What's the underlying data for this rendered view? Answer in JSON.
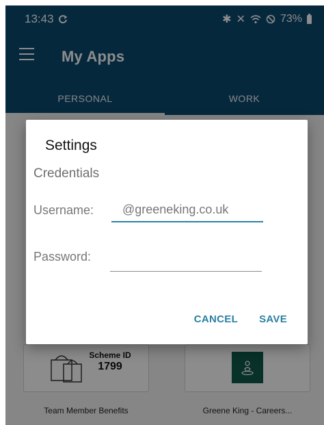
{
  "status_bar": {
    "time": "13:43",
    "sync_icon": "sync-icon",
    "icons": [
      "bluetooth-icon",
      "mute-icon",
      "wifi-icon",
      "do-not-disturb-icon"
    ],
    "battery": "73%"
  },
  "app_bar": {
    "menu_icon": "hamburger-menu-icon",
    "title": "My Apps"
  },
  "tabs": [
    {
      "label": "PERSONAL",
      "active": true
    },
    {
      "label": "WORK",
      "active": false
    }
  ],
  "apps": [
    {
      "name": "Team Member Benefits",
      "tile_line1": "Scheme ID",
      "tile_line2": "1799"
    },
    {
      "name": "Greene King - Careers...",
      "tile_color": "#0f5a4c"
    }
  ],
  "dialog": {
    "title": "Settings",
    "section": "Credentials",
    "username_label": "Username:",
    "username_value": "@greeneking.co.uk",
    "password_label": "Password:",
    "password_value": "",
    "cancel_label": "CANCEL",
    "save_label": "SAVE"
  },
  "colors": {
    "primary": "#0b4a6f",
    "accent": "#2a7fa4"
  }
}
